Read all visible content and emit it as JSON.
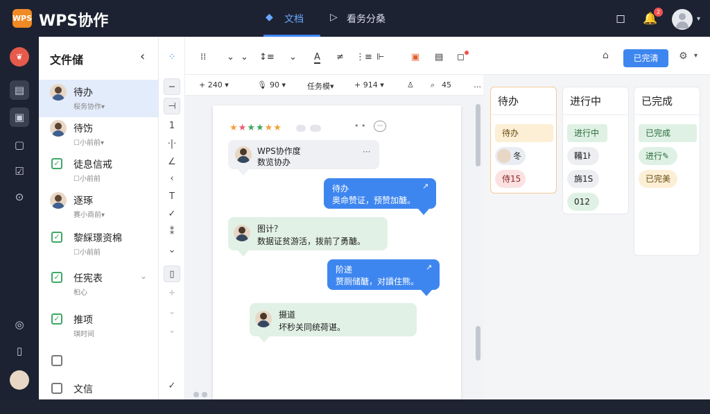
{
  "app": {
    "logo_text": "WPS",
    "name": "WPS协作"
  },
  "tabs": [
    {
      "label": "文档"
    },
    {
      "label": "看务分桑"
    }
  ],
  "notifications": {
    "count": "2"
  },
  "icons": {
    "tabs": [
      "doc-icon",
      "play-icon"
    ],
    "topbar": [
      "chat-icon",
      "bell-icon",
      "avatar-icon"
    ],
    "rail": [
      "brand-logo-icon",
      "table-icon",
      "file-icon",
      "document-icon",
      "checkbox-icon",
      "download-icon",
      "check-circle-icon",
      "page-icon",
      "avatar-icon"
    ]
  },
  "list": {
    "title": "文件储",
    "items": [
      {
        "title": "待办",
        "sub": "桜务协作▾"
      },
      {
        "title": "待饬",
        "sub": "☐小前前▾"
      },
      {
        "title": "徒息信戒",
        "sub": "☐小前前"
      },
      {
        "title": "逐琢",
        "sub": "赛小商前▾"
      },
      {
        "title": "黎綵璟资棉",
        "sub": "☐小前前"
      },
      {
        "title": "任宪表",
        "sub": "桕心"
      },
      {
        "title": "推项",
        "sub": "琪时间"
      },
      {
        "title": "",
        "sub": ""
      },
      {
        "title": "文信",
        "sub": ""
      }
    ]
  },
  "toolbar": {
    "row2": [
      "+ 240 ▾",
      "90 ▾",
      "任务模▾",
      "+ 914 ▾",
      "45"
    ]
  },
  "document": {
    "stars": "★★★★★★",
    "header_icons": "• •",
    "messages": [
      {
        "title": "WPS协作度",
        "body": "数览协办",
        "more": "···"
      },
      {
        "title": "待办",
        "body": "奥命赞证，预赞加醣。",
        "mark": "↗"
      },
      {
        "title": "图计？",
        "body": "数据证贫游活，拨前了勇醣。"
      },
      {
        "title": "阶递",
        "body": "赘厕储醣，对讀住熊。",
        "mark": "↗"
      },
      {
        "title": "摄道",
        "body": "坏秒关同统荷谌。"
      }
    ]
  },
  "kanban": {
    "done_button": "已完清",
    "columns": [
      {
        "title": "待办",
        "cards": [
          {
            "text": "待办"
          },
          {
            "text": "冬"
          },
          {
            "text": "侍15"
          }
        ]
      },
      {
        "title": "进行中",
        "cards": [
          {
            "text": "进行中"
          },
          {
            "text": "鞴1ŀ"
          },
          {
            "text": "旆1S"
          },
          {
            "text": "012"
          }
        ]
      },
      {
        "title": "已完成",
        "cards": [
          {
            "text": "已完成"
          },
          {
            "text": "进行✎"
          },
          {
            "text": "已完美"
          }
        ]
      }
    ]
  }
}
